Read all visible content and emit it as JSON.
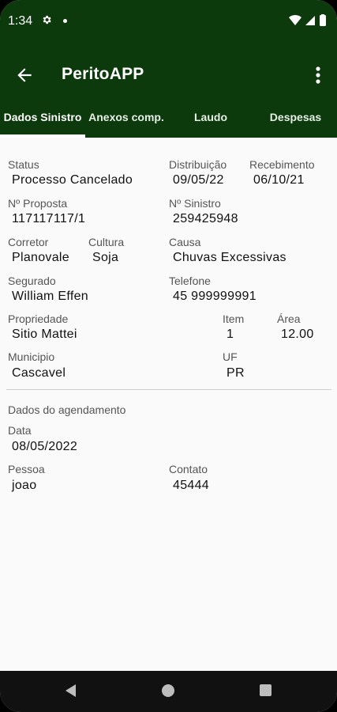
{
  "status_bar": {
    "time": "1:34",
    "icons": [
      "gear-icon",
      "notification-dot-icon",
      "wifi-icon",
      "signal-icon",
      "battery-icon"
    ]
  },
  "app_bar": {
    "title": "PeritoAPP",
    "back_icon": "arrow-left-icon",
    "menu_icon": "more-vert-icon"
  },
  "tabs": [
    {
      "label": "Dados Sinistro",
      "active": true
    },
    {
      "label": "Anexos comp.",
      "active": false
    },
    {
      "label": "Laudo",
      "active": false
    },
    {
      "label": "Despesas",
      "active": false
    }
  ],
  "fields": {
    "status": {
      "label": "Status",
      "value": "Processo Cancelado"
    },
    "distribuicao": {
      "label": "Distribuição",
      "value": "09/05/22"
    },
    "recebimento": {
      "label": "Recebimento",
      "value": "06/10/21"
    },
    "proposta": {
      "label": "Nº Proposta",
      "value": "117117117/1"
    },
    "sinistro": {
      "label": "Nº Sinistro",
      "value": "259425948"
    },
    "corretor": {
      "label": "Corretor",
      "value": "Planovale"
    },
    "cultura": {
      "label": "Cultura",
      "value": "Soja"
    },
    "causa": {
      "label": "Causa",
      "value": "Chuvas Excessivas"
    },
    "segurado": {
      "label": "Segurado",
      "value": "William Effen"
    },
    "telefone": {
      "label": "Telefone",
      "value": "45 999999991"
    },
    "propriedade": {
      "label": "Propriedade",
      "value": "Sitio Mattei"
    },
    "item": {
      "label": "Item",
      "value": "1"
    },
    "area": {
      "label": "Área",
      "value": "12.00"
    },
    "municipio": {
      "label": "Municipio",
      "value": "Cascavel"
    },
    "uf": {
      "label": "UF",
      "value": "PR"
    }
  },
  "agendamento": {
    "section_title": "Dados do agendamento",
    "data": {
      "label": "Data",
      "value": "08/05/2022"
    },
    "pessoa": {
      "label": "Pessoa",
      "value": "joao"
    },
    "contato": {
      "label": "Contato",
      "value": "45444"
    }
  },
  "colors": {
    "primary": "#0c3a0c",
    "background": "#fafafa",
    "nav_bar": "#111111"
  }
}
